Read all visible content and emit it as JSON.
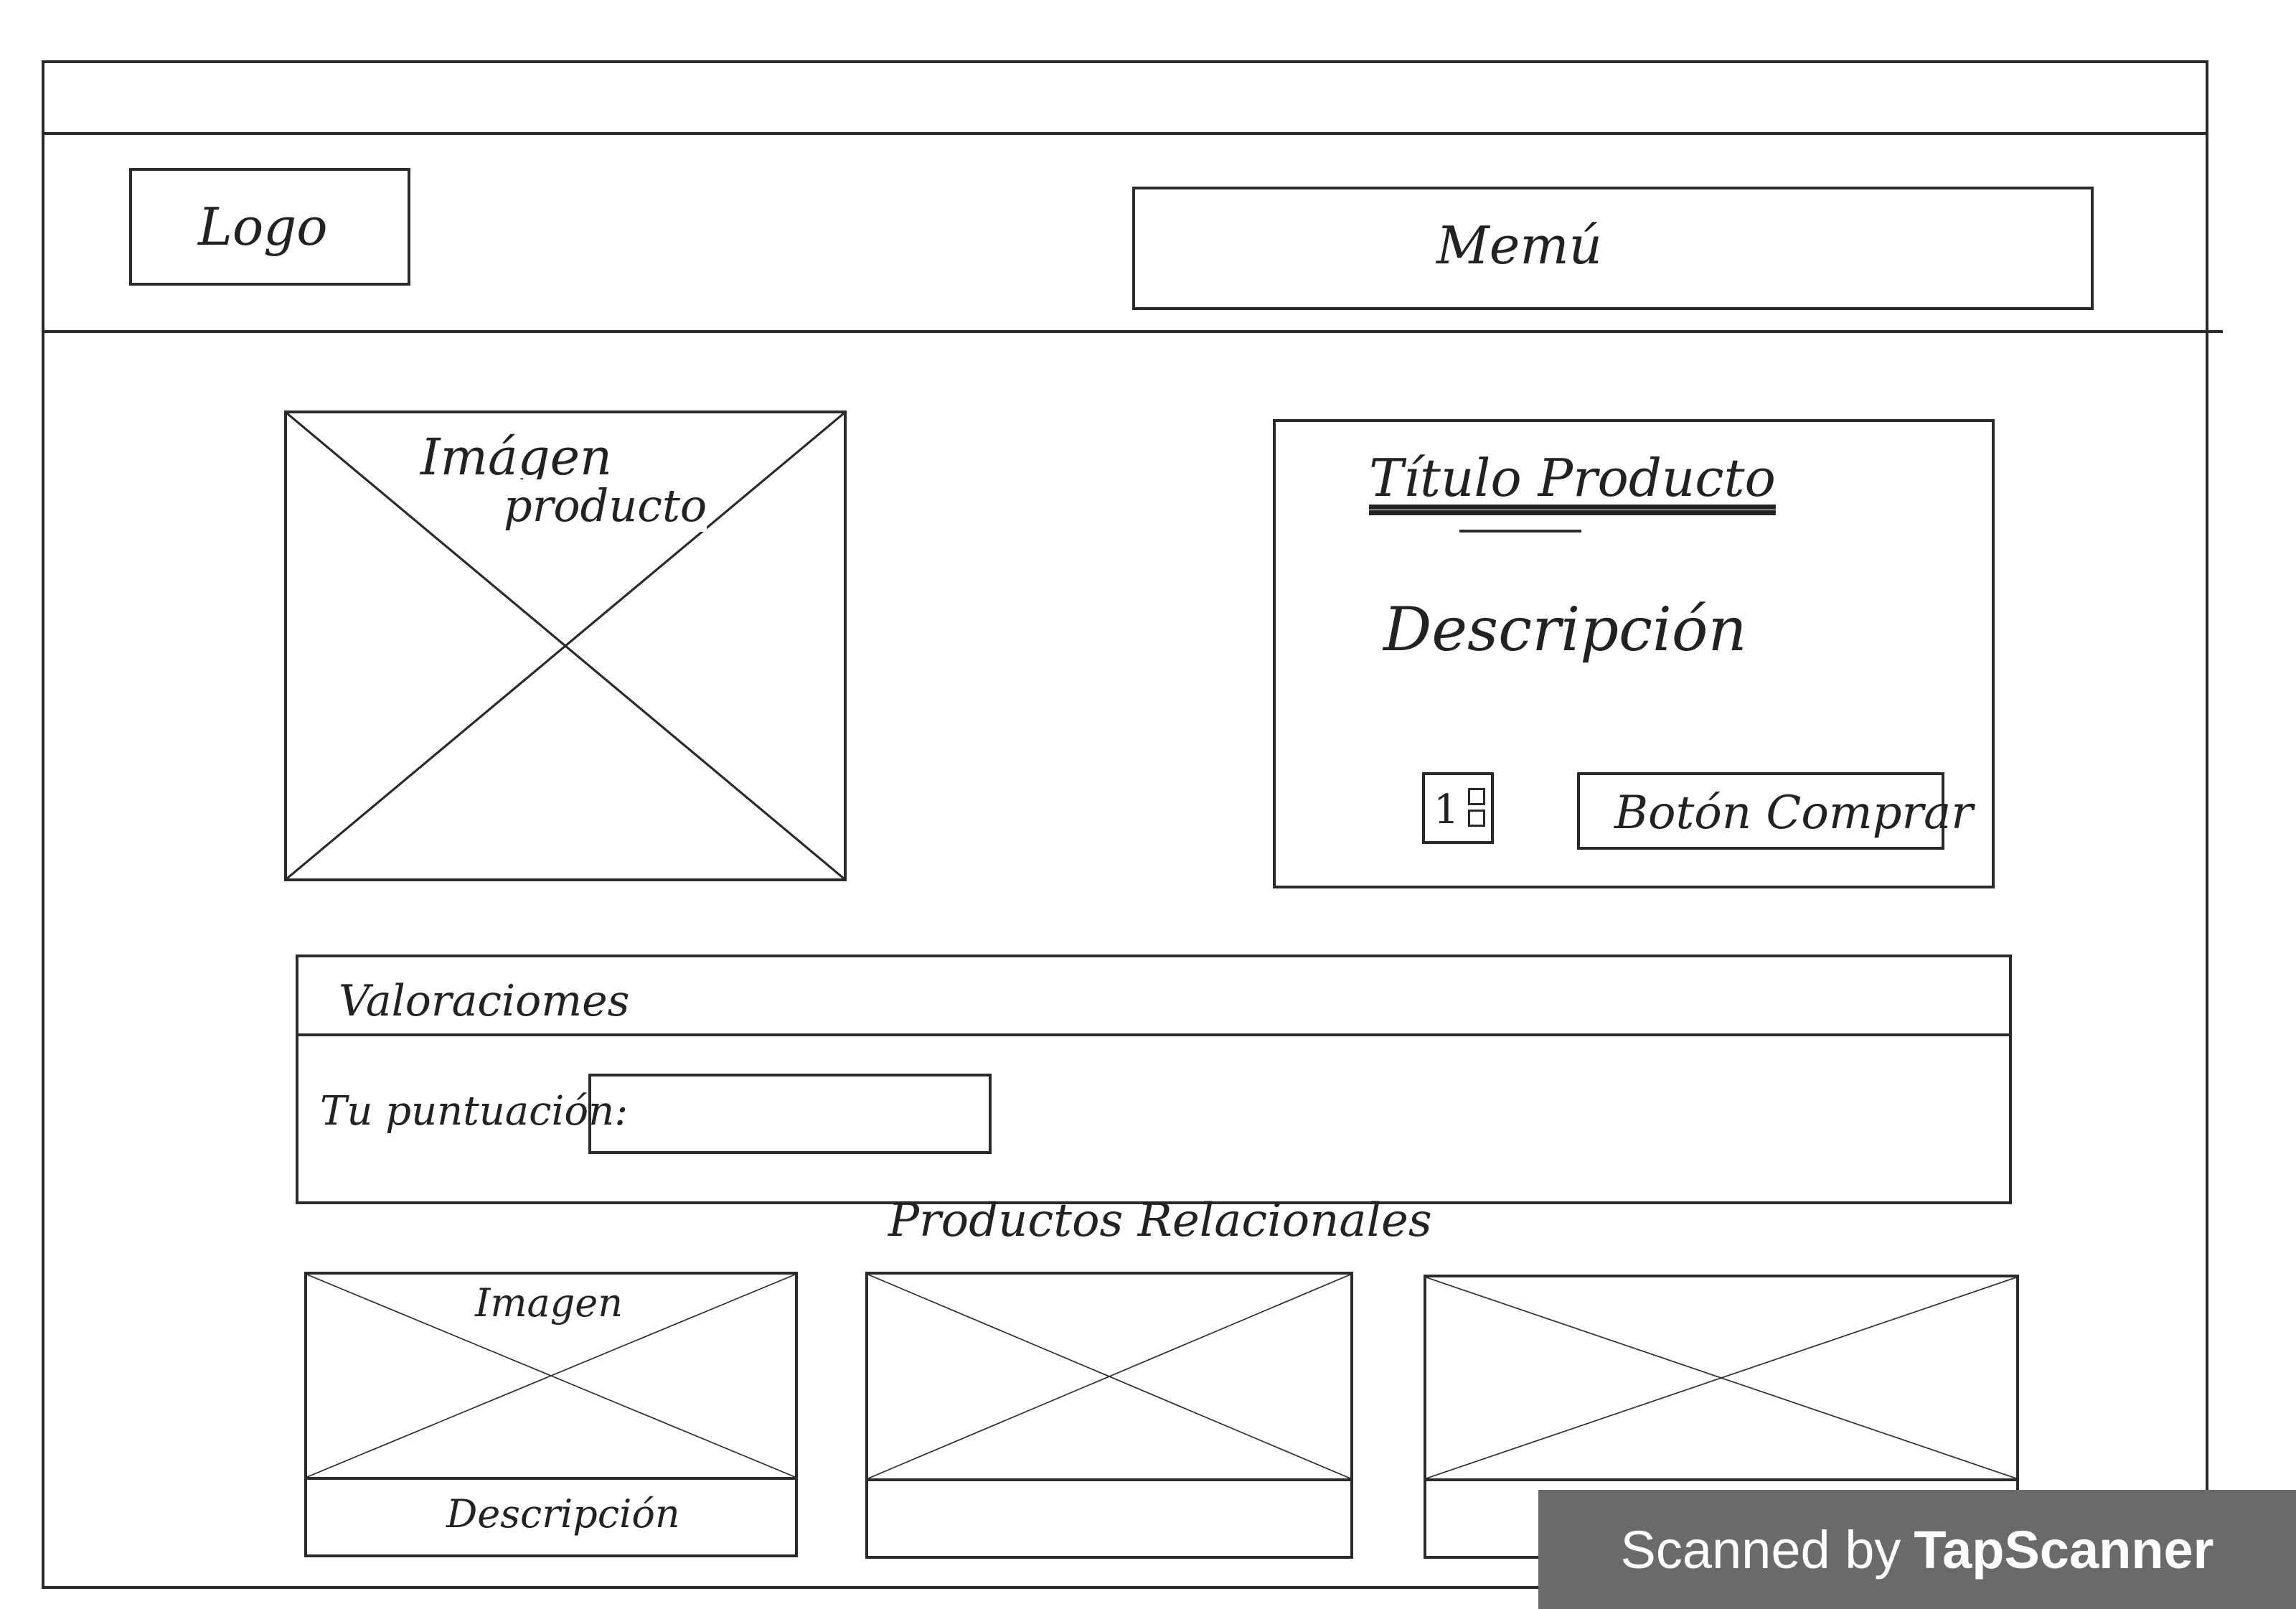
{
  "header": {
    "logo_label": "Logo",
    "menu_label": "Memú"
  },
  "product": {
    "image_label_line1": "Imágen",
    "image_label_line2": "producto",
    "title": "Título Producto",
    "description": "Descripción",
    "quantity": "1",
    "buy_button_label": "Botón Comprar"
  },
  "ratings": {
    "header": "Valoraciomes",
    "score_label": "Tu puntuación:",
    "score_value": ""
  },
  "related": {
    "title": "Productos Relacionales",
    "cards": [
      {
        "image_label": "Imagen",
        "description": "Descripción"
      },
      {
        "image_label": "",
        "description": ""
      },
      {
        "image_label": "",
        "description": ""
      }
    ]
  },
  "watermark": {
    "prefix": "Scanned by",
    "brand": "TapScanner"
  }
}
